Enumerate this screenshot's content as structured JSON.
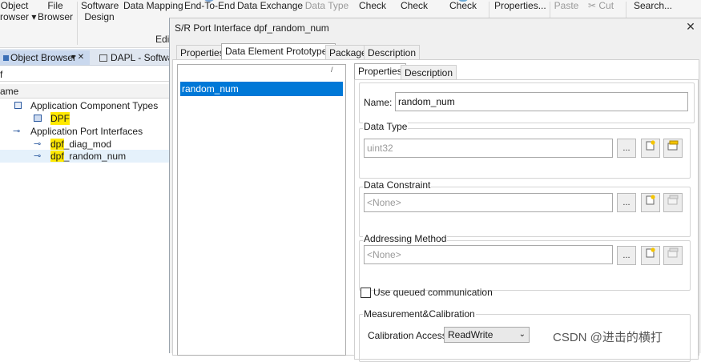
{
  "ribbon": {
    "buttons": [
      {
        "line1": "Object",
        "line2": "rowser ▾"
      },
      {
        "line1": "File",
        "line2": "Browser"
      },
      {
        "line1": "Software",
        "line2": "Design"
      },
      {
        "line1": "Data Mapping",
        "line2": ""
      },
      {
        "line1": "End-To-End",
        "line2": ""
      },
      {
        "line1": "Data Exchange",
        "line2": ""
      },
      {
        "line1": "Data Type",
        "line2": ""
      },
      {
        "line1": "Check",
        "line2": ""
      },
      {
        "line1": "Check",
        "line2": ""
      },
      {
        "line1": "Check",
        "line2": ""
      },
      {
        "line1": "Properties...",
        "line2": ""
      },
      {
        "line1": "Paste",
        "line2": ""
      },
      {
        "line1": "Cut",
        "line2": ""
      },
      {
        "line1": "Search...",
        "line2": ""
      }
    ],
    "group_label": "Edi"
  },
  "left_panel": {
    "tabs": [
      {
        "label": "Object Browser",
        "pin": "▾ ✕"
      },
      {
        "label": "DAPL - Softwa"
      }
    ],
    "search_value": "f",
    "column_header": "ame",
    "tree": [
      {
        "label": "Application Component Types",
        "icon": "component-types-icon"
      },
      {
        "prefix": "DPF",
        "suffix": "",
        "icon": "component-icon"
      },
      {
        "label": "Application Port Interfaces",
        "icon": "port-interfaces-icon"
      },
      {
        "prefix": "dpf",
        "suffix": "_diag_mod",
        "icon": "port-interface-icon"
      },
      {
        "prefix": "dpf",
        "suffix": "_random_num",
        "icon": "port-interface-icon"
      }
    ]
  },
  "dialog": {
    "title": "S/R Port Interface dpf_random_num",
    "close": "✕",
    "tabs": [
      "Properties",
      "Data Element Prototypes",
      "Package",
      "Description"
    ],
    "list_sort_marker": "/",
    "list_items": [
      "random_num"
    ],
    "inner_tabs": [
      "Properties",
      "Description"
    ],
    "name_label": "Name:",
    "name_value": "random_num",
    "data_type_label": "Data Type",
    "data_type_value": "uint32",
    "data_constraint_label": "Data Constraint",
    "data_constraint_value": "<None>",
    "addressing_label": "Addressing Method",
    "addressing_value": "<None>",
    "browse_label": "...",
    "queued_label": "Use queued communication",
    "queued_checked": false,
    "measurement_label": "Measurement&Calibration",
    "calibration_label": "Calibration Access:",
    "calibration_value": "ReadWrite"
  },
  "watermark": "CSDN @进击的横打",
  "colors": {
    "selection": "#0078d7",
    "highlight": "#ffe900",
    "accent_blue": "#1f5fbf"
  }
}
